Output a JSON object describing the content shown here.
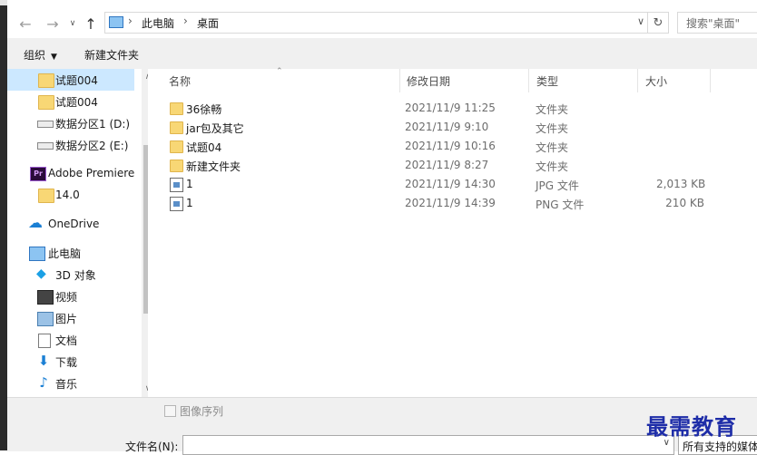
{
  "nav": {
    "back": "←",
    "forward": "→",
    "up": "↑",
    "breadcrumb": [
      "此电脑",
      "桌面"
    ],
    "breadcrumb_sep": "›",
    "refresh": "↻",
    "search_placeholder": "搜索\"桌面\""
  },
  "toolbar": {
    "organize": "组织",
    "new_folder": "新建文件夹"
  },
  "sidebar": {
    "items": [
      {
        "label": "试题004",
        "icon": "folder-icon",
        "selected": true
      },
      {
        "label": "试题004",
        "icon": "folder-icon"
      },
      {
        "label": "数据分区1 (D:)",
        "icon": "drive-icon"
      },
      {
        "label": "数据分区2 (E:)",
        "icon": "drive-icon"
      },
      {
        "label": "Adobe Premiere",
        "icon": "premiere-icon"
      },
      {
        "label": "14.0",
        "icon": "folder-icon"
      },
      {
        "label": "OneDrive",
        "icon": "onedrive-icon"
      },
      {
        "label": "此电脑",
        "icon": "this-pc-icon"
      },
      {
        "label": "3D 对象",
        "icon": "3d-objects-icon"
      },
      {
        "label": "视频",
        "icon": "videos-icon"
      },
      {
        "label": "图片",
        "icon": "pictures-icon"
      },
      {
        "label": "文档",
        "icon": "documents-icon"
      },
      {
        "label": "下载",
        "icon": "downloads-icon"
      },
      {
        "label": "音乐",
        "icon": "music-icon"
      }
    ],
    "premiere_badge": "Pr"
  },
  "columns": {
    "name": "名称",
    "date": "修改日期",
    "type": "类型",
    "size": "大小"
  },
  "files": [
    {
      "name": "36徐畅",
      "date": "2021/11/9 11:25",
      "type": "文件夹",
      "size": "",
      "icon": "folder-icon"
    },
    {
      "name": "jar包及其它",
      "date": "2021/11/9 9:10",
      "type": "文件夹",
      "size": "",
      "icon": "folder-icon"
    },
    {
      "name": "试题04",
      "date": "2021/11/9 10:16",
      "type": "文件夹",
      "size": "",
      "icon": "folder-icon"
    },
    {
      "name": "新建文件夹",
      "date": "2021/11/9 8:27",
      "type": "文件夹",
      "size": "",
      "icon": "folder-icon"
    },
    {
      "name": "1",
      "date": "2021/11/9 14:30",
      "type": "JPG 文件",
      "size": "2,013 KB",
      "icon": "image-file-icon"
    },
    {
      "name": "1",
      "date": "2021/11/9 14:39",
      "type": "PNG 文件",
      "size": "210 KB",
      "icon": "image-file-icon"
    }
  ],
  "bottom": {
    "sequence_label": "图像序列",
    "filename_label": "文件名(N):",
    "filename_value": "",
    "filter_value": "所有支持的媒体"
  },
  "watermark": "最需教育"
}
